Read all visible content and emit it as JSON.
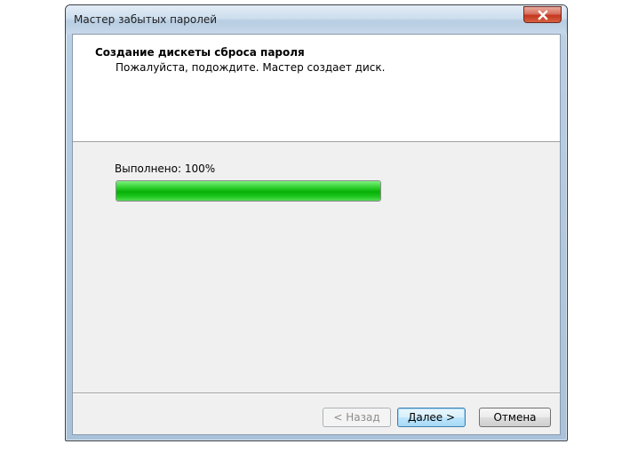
{
  "window": {
    "title": "Мастер забытых паролей"
  },
  "header": {
    "title": "Создание дискеты сброса пароля",
    "subtitle": "Пожалуйста, подождите. Мастер создает диск."
  },
  "progress": {
    "label": "Выполнено: 100%",
    "percent": 100,
    "color": "#00b400"
  },
  "buttons": {
    "back": "< Назад",
    "next": "Далее >",
    "cancel": "Отмена"
  },
  "icons": {
    "close": "close-icon"
  }
}
